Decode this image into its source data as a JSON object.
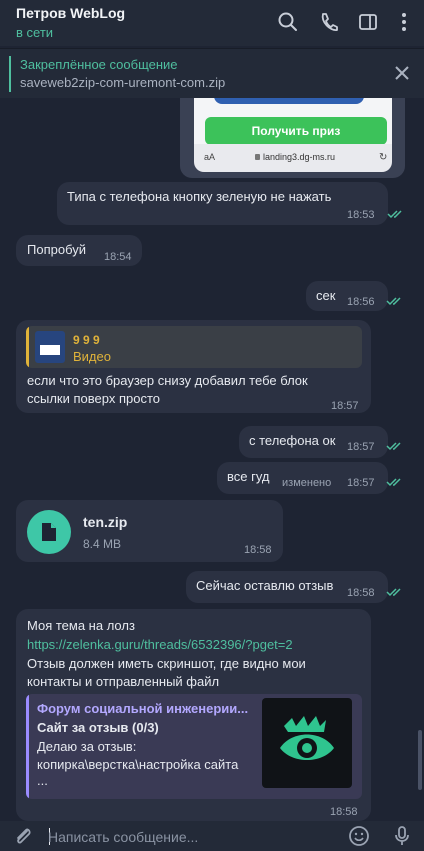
{
  "header": {
    "title": "Петров WebLog",
    "status": "в сети",
    "icons": [
      "search-icon",
      "phone-icon",
      "sidebar-icon",
      "more-icon"
    ]
  },
  "pinned": {
    "title": "Закреплённое сообщение",
    "text": "saveweb2zip-com-uremont-com.zip"
  },
  "screenshot_preview": {
    "button_label": "Получить приз",
    "address_aa": "aA",
    "address_url": "landing3.dg-ms.ru"
  },
  "messages": [
    {
      "text": "Типа с телефона кнопку зеленую не нажать",
      "time": "18:53"
    },
    {
      "text": "Попробуй",
      "time": "18:54"
    },
    {
      "text": "сек",
      "time": "18:56"
    },
    {
      "reply_title": "9 9 9",
      "reply_sub": "Видео",
      "text_line1": "если что это браузер снизу добавил тебе блок",
      "text_line2": "ссылки поверх просто",
      "time": "18:57"
    },
    {
      "text": "с телефона ок",
      "time": "18:57"
    },
    {
      "text": "все гуд",
      "time": "18:57",
      "edited": "изменено"
    },
    {
      "file_name": "ten.zip",
      "file_size": "8.4 MB",
      "time": "18:58"
    },
    {
      "text": "Сейчас оставлю отзыв",
      "time": "18:58"
    },
    {
      "line1": "Моя тема на лолз",
      "link": "https://zelenka.guru/threads/6532396/?pget=2",
      "line3": "Отзыв должен иметь скриншот, где видно мои",
      "line4": "контакты и отправленный файл",
      "preview_site": "Форум социальной инженерии...",
      "preview_title": "Сайт за отзыв (0/3)",
      "preview_desc1": "Делаю за отзыв:",
      "preview_desc2": "копирка\\верстка\\настройка сайта",
      "preview_desc3": "...",
      "time": "18:58"
    }
  ],
  "composer": {
    "placeholder": "Написать сообщение...",
    "icons": [
      "attach-icon",
      "emoji-icon",
      "microphone-icon"
    ]
  },
  "colors": {
    "accent": "#4fbf9f",
    "background": "#1e2433",
    "bubble": "#2b3142",
    "reply_accent": "#e0b33a",
    "preview_accent": "#9b8cff"
  }
}
